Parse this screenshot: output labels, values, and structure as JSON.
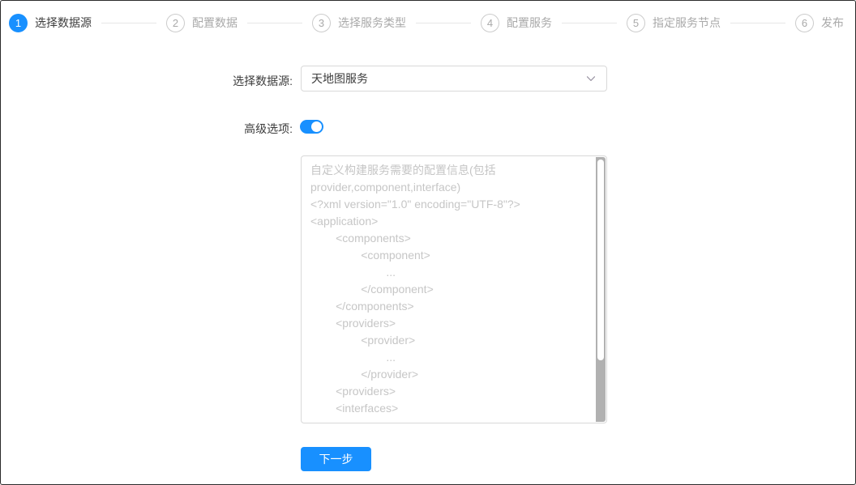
{
  "colors": {
    "accent": "#1890ff"
  },
  "stepper": {
    "steps": [
      {
        "num": "1",
        "label": "选择数据源",
        "active": true
      },
      {
        "num": "2",
        "label": "配置数据",
        "active": false
      },
      {
        "num": "3",
        "label": "选择服务类型",
        "active": false
      },
      {
        "num": "4",
        "label": "配置服务",
        "active": false
      },
      {
        "num": "5",
        "label": "指定服务节点",
        "active": false
      },
      {
        "num": "6",
        "label": "发布",
        "active": false
      }
    ]
  },
  "form": {
    "datasource_label": "选择数据源:",
    "datasource_value": "天地图服务",
    "advanced_label": "高级选项:",
    "advanced_on": true,
    "config_placeholder": "自定义构建服务需要的配置信息(包括provider,component,interface)\n<?xml version=\"1.0\" encoding=\"UTF-8\"?>\n<application>\n        <components>\n                <component>\n                        ...\n                </component>\n        </components>\n        <providers>\n                <provider>\n                        ...\n                </provider>\n        <providers>\n        <interfaces>",
    "next_button_label": "下一步"
  }
}
